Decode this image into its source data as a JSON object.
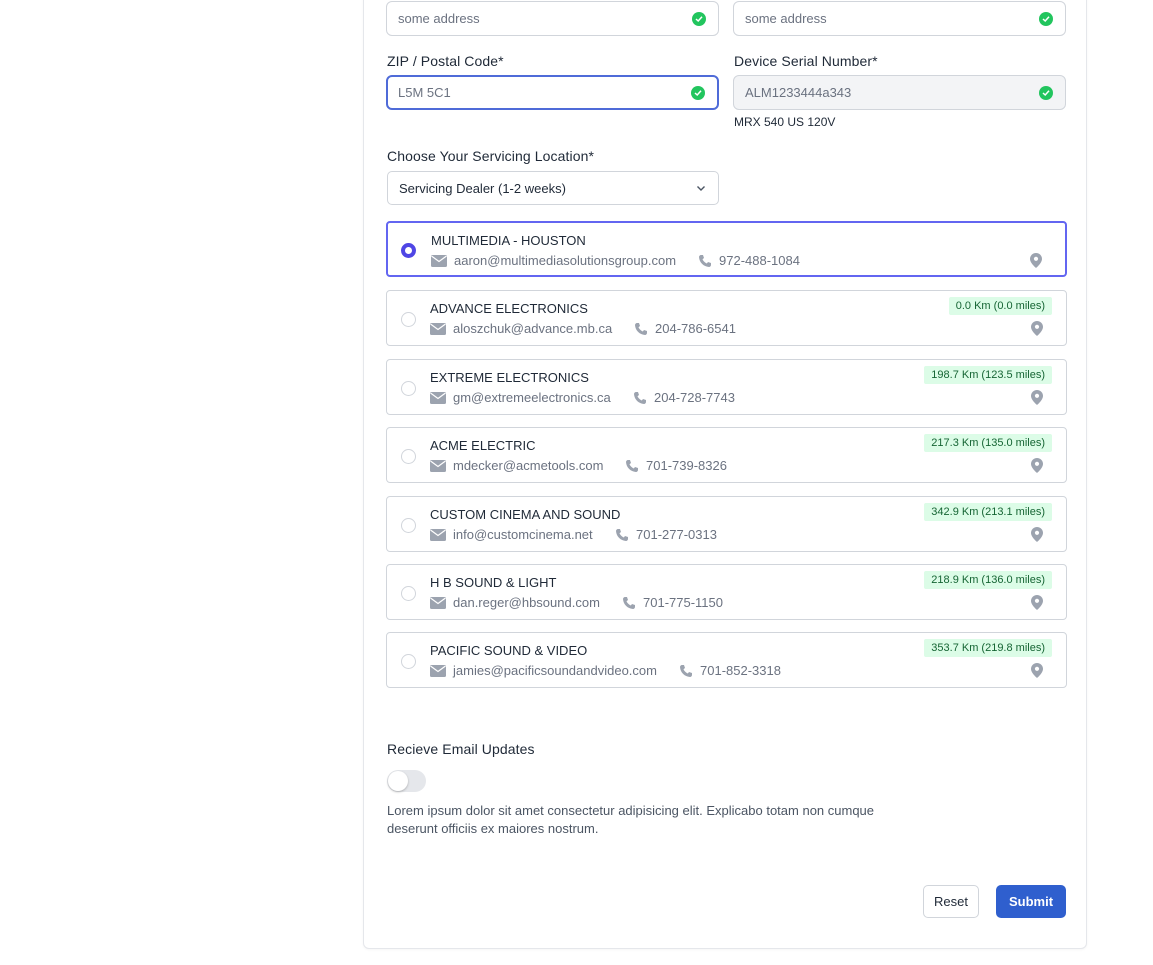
{
  "form": {
    "address_1": {
      "placeholder": "some address"
    },
    "address_2": {
      "placeholder": "some address"
    },
    "zip": {
      "label": "ZIP / Postal Code*",
      "value": "L5M 5C1"
    },
    "serial": {
      "label": "Device Serial Number*",
      "value": "ALM1233444a343",
      "model": "MRX 540 US 120V"
    },
    "location": {
      "label": "Choose Your Servicing Location*",
      "selected": "Servicing Dealer (1-2 weeks)"
    }
  },
  "dealers": [
    {
      "name": "MULTIMEDIA - HOUSTON",
      "email": "aaron@multimediasolutionsgroup.com",
      "phone": "972-488-1084",
      "distance": "",
      "selected": true
    },
    {
      "name": "ADVANCE ELECTRONICS",
      "email": "aloszchuk@advance.mb.ca",
      "phone": "204-786-6541",
      "distance": "0.0 Km (0.0 miles)",
      "selected": false
    },
    {
      "name": "EXTREME ELECTRONICS",
      "email": "gm@extremeelectronics.ca",
      "phone": "204-728-7743",
      "distance": "198.7 Km (123.5 miles)",
      "selected": false
    },
    {
      "name": "ACME ELECTRIC",
      "email": "mdecker@acmetools.com",
      "phone": "701-739-8326",
      "distance": "217.3 Km (135.0 miles)",
      "selected": false
    },
    {
      "name": "CUSTOM CINEMA AND SOUND",
      "email": "info@customcinema.net",
      "phone": "701-277-0313",
      "distance": "342.9 Km (213.1 miles)",
      "selected": false
    },
    {
      "name": "H B SOUND & LIGHT",
      "email": "dan.reger@hbsound.com",
      "phone": "701-775-1150",
      "distance": "218.9 Km (136.0 miles)",
      "selected": false
    },
    {
      "name": "PACIFIC SOUND & VIDEO",
      "email": "jamies@pacificsoundandvideo.com",
      "phone": "701-852-3318",
      "distance": "353.7 Km (219.8 miles)",
      "selected": false
    }
  ],
  "email_updates": {
    "label": "Recieve Email Updates",
    "enabled": false,
    "description": "Lorem ipsum dolor sit amet consectetur adipisicing elit. Explicabo totam non cumque deserunt officiis ex maiores nostrum."
  },
  "actions": {
    "reset": "Reset",
    "submit": "Submit"
  },
  "colors": {
    "accent": "#4f46e5",
    "submit": "#2f5fce",
    "success": "#22c55e",
    "distance_bg": "#dcfce7"
  },
  "icons": [
    "check-circle-icon",
    "chevron-down-icon",
    "mail-icon",
    "phone-icon",
    "map-pin-icon"
  ]
}
